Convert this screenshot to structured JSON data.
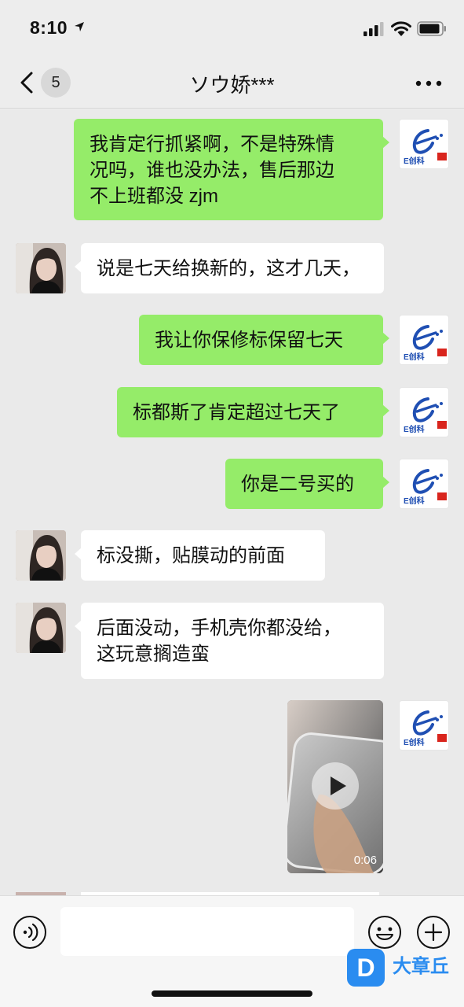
{
  "status_bar": {
    "time": "8:10"
  },
  "nav": {
    "unread_count": "5",
    "title": "ソウ娇***"
  },
  "contact": {
    "brand_logo_text": "E创科"
  },
  "messages": [
    {
      "from": "me",
      "lines": [
        "我肯定行抓紧啊，不是特殊情",
        "况吗，谁也没办法，售后那边",
        "不上班都没 zjm"
      ]
    },
    {
      "from": "them",
      "lines": [
        "说是七天给换新的，这才几天，"
      ]
    },
    {
      "from": "me",
      "lines": [
        "我让你保修标保留七天"
      ]
    },
    {
      "from": "me",
      "lines": [
        "标都斯了肯定超过七天了"
      ]
    },
    {
      "from": "me",
      "lines": [
        "你是二号买的"
      ]
    },
    {
      "from": "them",
      "lines": [
        "标没撕，贴膜动的前面"
      ]
    },
    {
      "from": "them",
      "lines": [
        "后面没动，手机壳你都没给，",
        "这玩意搁造蛮"
      ]
    },
    {
      "from": "me",
      "type": "video",
      "duration": "0:06"
    }
  ],
  "input": {
    "placeholder": ""
  },
  "watermark": {
    "logo": "D",
    "text": "大章丘"
  },
  "colors": {
    "outgoing_bubble": "#95ec69",
    "incoming_bubble": "#ffffff",
    "chat_background": "#eaeaea"
  },
  "icons": [
    "location-arrow-icon",
    "signal-icon",
    "wifi-icon",
    "battery-icon",
    "back-chevron-icon",
    "more-icon",
    "play-icon",
    "voice-icon",
    "emoji-icon",
    "plus-icon"
  ]
}
